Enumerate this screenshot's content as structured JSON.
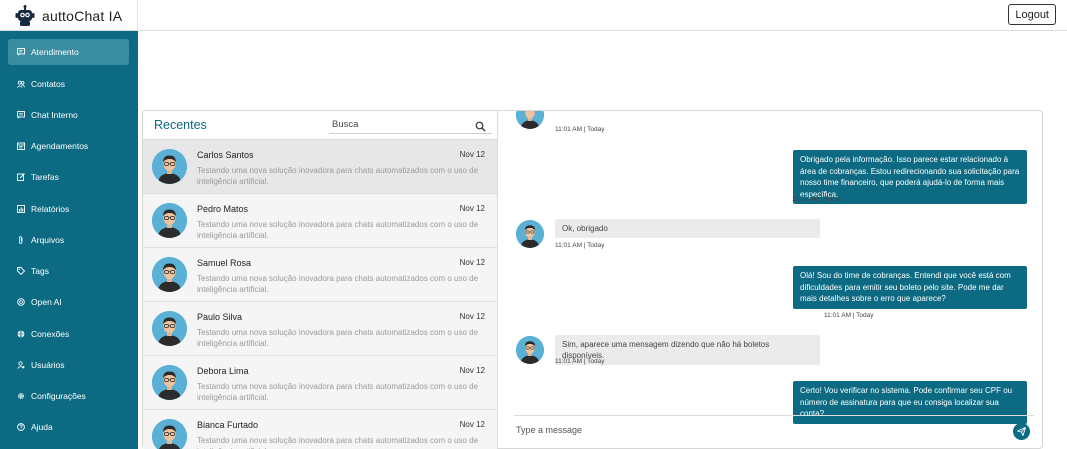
{
  "app": {
    "name": "auttoChat IA",
    "logout_label": "Logout"
  },
  "sidebar": {
    "items": [
      {
        "label": "Atendimento",
        "icon": "chat-icon",
        "active": true
      },
      {
        "label": "Contatos",
        "icon": "contacts-icon"
      },
      {
        "label": "Chat Interno",
        "icon": "message-icon"
      },
      {
        "label": "Agendamentos",
        "icon": "calendar-icon"
      },
      {
        "label": "Tarefas",
        "icon": "edit-icon"
      },
      {
        "label": "Relatórios",
        "icon": "report-icon"
      },
      {
        "label": "Arquivos",
        "icon": "paperclip-icon"
      },
      {
        "label": "Tags",
        "icon": "tag-icon"
      },
      {
        "label": "Open AI",
        "icon": "openai-icon"
      },
      {
        "label": "Conexões",
        "icon": "globe-icon"
      },
      {
        "label": "Usuários",
        "icon": "user-icon"
      },
      {
        "label": "Configurações",
        "icon": "gear-icon"
      },
      {
        "label": "Ajuda",
        "icon": "help-icon"
      }
    ]
  },
  "recents": {
    "title": "Recentes",
    "search_placeholder": "Busca",
    "contacts": [
      {
        "name": "Carlos Santos",
        "date": "Nov 12",
        "preview": "Testando uma nova solução inovadora para chats automatizados com o uso de inteligência artificial.",
        "active": true
      },
      {
        "name": "Pedro Matos",
        "date": "Nov 12",
        "preview": "Testando uma nova solução inovadora para chats automatizados com o uso de inteligência artificial."
      },
      {
        "name": "Samuel Rosa",
        "date": "Nov 12",
        "preview": "Testando uma nova solução inovadora para chats automatizados com o uso de inteligência artificial."
      },
      {
        "name": "Paulo Silva",
        "date": "Nov 12",
        "preview": "Testando uma nova solução inovadora para chats automatizados com o uso de inteligência artificial."
      },
      {
        "name": "Debora Lima",
        "date": "Nov 12",
        "preview": "Testando uma nova solução inovadora para chats automatizados com o uso de inteligência artificial."
      },
      {
        "name": "Bianca Furtado",
        "date": "Nov 12",
        "preview": "Testando uma nova solução inovadora para chats automatizados com o uso de inteligência artificial."
      }
    ]
  },
  "chat": {
    "messages": [
      {
        "from": "contact",
        "text": "",
        "time": "11:01 AM | Today"
      },
      {
        "from": "agent",
        "text": "Obrigado pela informação. Isso parece estar relacionado à área de cobranças. Estou redirecionando sua solicitação para nosso time financeiro, que poderá ajudá-lo de forma mais específica.",
        "time": "11:01 AM | Today"
      },
      {
        "from": "contact",
        "text": "Ok, obrigado",
        "time": "11:01 AM | Today"
      },
      {
        "from": "agent",
        "text": "Olá! Sou do time de cobranças. Entendi que você está com dificuldades para emitir seu boleto pelo site. Pode me dar mais detalhes sobre o erro que aparece?",
        "time": "11:01 AM | Today"
      },
      {
        "from": "contact",
        "text": "Sim, aparece uma mensagem dizendo que não há boletos disponíveis.",
        "time": "11:01 AM | Today"
      },
      {
        "from": "agent",
        "text": "Certo! Vou verificar no sistema. Pode confirmar seu CPF ou número de assinatura para que eu consiga localizar sua conta?",
        "time": ""
      }
    ],
    "composer_placeholder": "Type a message"
  }
}
